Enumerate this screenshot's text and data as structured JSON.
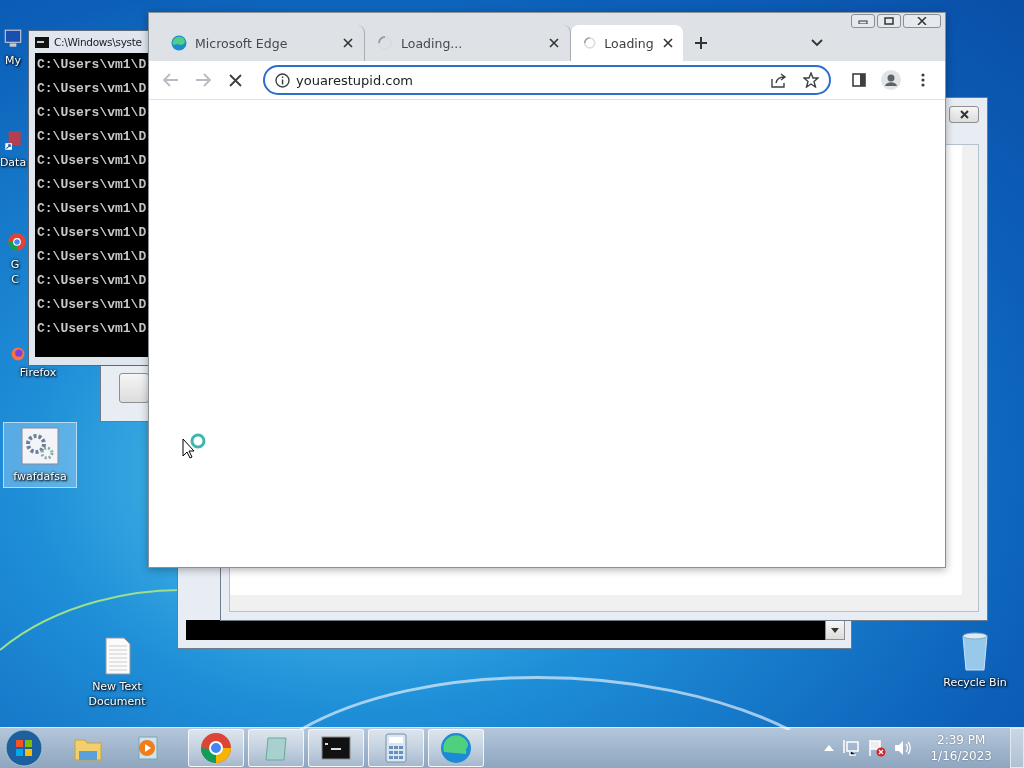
{
  "desktop_icons": [
    {
      "kind": "computer",
      "lines": [
        "My"
      ],
      "selected": false
    },
    {
      "kind": "shortcut",
      "lines": [
        "Data"
      ],
      "selected": false
    },
    {
      "kind": "chrome",
      "lines": [
        "G",
        "C"
      ],
      "selected": false
    },
    {
      "kind": "firefox",
      "lines": [
        "Firefox"
      ],
      "selected": false
    },
    {
      "kind": "settings",
      "lines": [
        "fwafdafsa"
      ],
      "selected": true
    },
    {
      "kind": "text",
      "lines": [
        "New Text",
        "Document"
      ],
      "selected": false
    },
    {
      "kind": "recycle",
      "lines": [
        "Recycle Bin"
      ],
      "selected": false
    }
  ],
  "cmd_window": {
    "title": "C:\\Windows\\syste",
    "lines": [
      "C:\\Users\\vm1\\D",
      "C:\\Users\\vm1\\D",
      "C:\\Users\\vm1\\D",
      "C:\\Users\\vm1\\D",
      "C:\\Users\\vm1\\D",
      "C:\\Users\\vm1\\D",
      "C:\\Users\\vm1\\D",
      "C:\\Users\\vm1\\D",
      "C:\\Users\\vm1\\D",
      "C:\\Users\\vm1\\D",
      "C:\\Users\\vm1\\D",
      "C:\\Users\\vm1\\D"
    ]
  },
  "browser": {
    "tabs": [
      {
        "kind": "edge",
        "title": "Microsoft Edge",
        "selected": false
      },
      {
        "kind": "loading",
        "title": "Loading...",
        "selected": false
      },
      {
        "kind": "loading",
        "title": "Loading",
        "selected": true
      }
    ],
    "address": "youarestupid.com"
  },
  "taskbar": {
    "items": [
      {
        "kind": "explorer",
        "running": false
      },
      {
        "kind": "media",
        "running": false
      },
      {
        "kind": "chrome",
        "running": true
      },
      {
        "kind": "notepad",
        "running": true
      },
      {
        "kind": "cmd",
        "running": true
      },
      {
        "kind": "calculator",
        "running": true
      },
      {
        "kind": "edge",
        "running": true
      }
    ],
    "time": "2:39 PM",
    "date": "1/16/2023"
  }
}
